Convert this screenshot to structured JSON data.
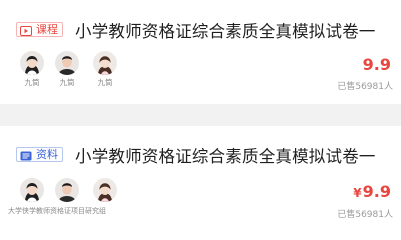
{
  "cards": [
    {
      "tag_label": "课程",
      "tag_icon": "video-play-icon",
      "tag_color": "#e8463f",
      "title": "小学教师资格证综合素质全真模拟试卷一",
      "teachers": [
        {
          "name": "九筒"
        },
        {
          "name": "九筒"
        },
        {
          "name": "九筒"
        }
      ],
      "price": "9.9",
      "sold": "已售56981人"
    },
    {
      "tag_label": "资料",
      "tag_icon": "document-icon",
      "tag_color": "#3d64d8",
      "title": "小学教师资格证综合素质全真模拟试卷一",
      "org": "大学侠学教师资格证项目研究组",
      "price_currency": "¥",
      "price": "9.9",
      "sold": "已售56981人"
    }
  ]
}
